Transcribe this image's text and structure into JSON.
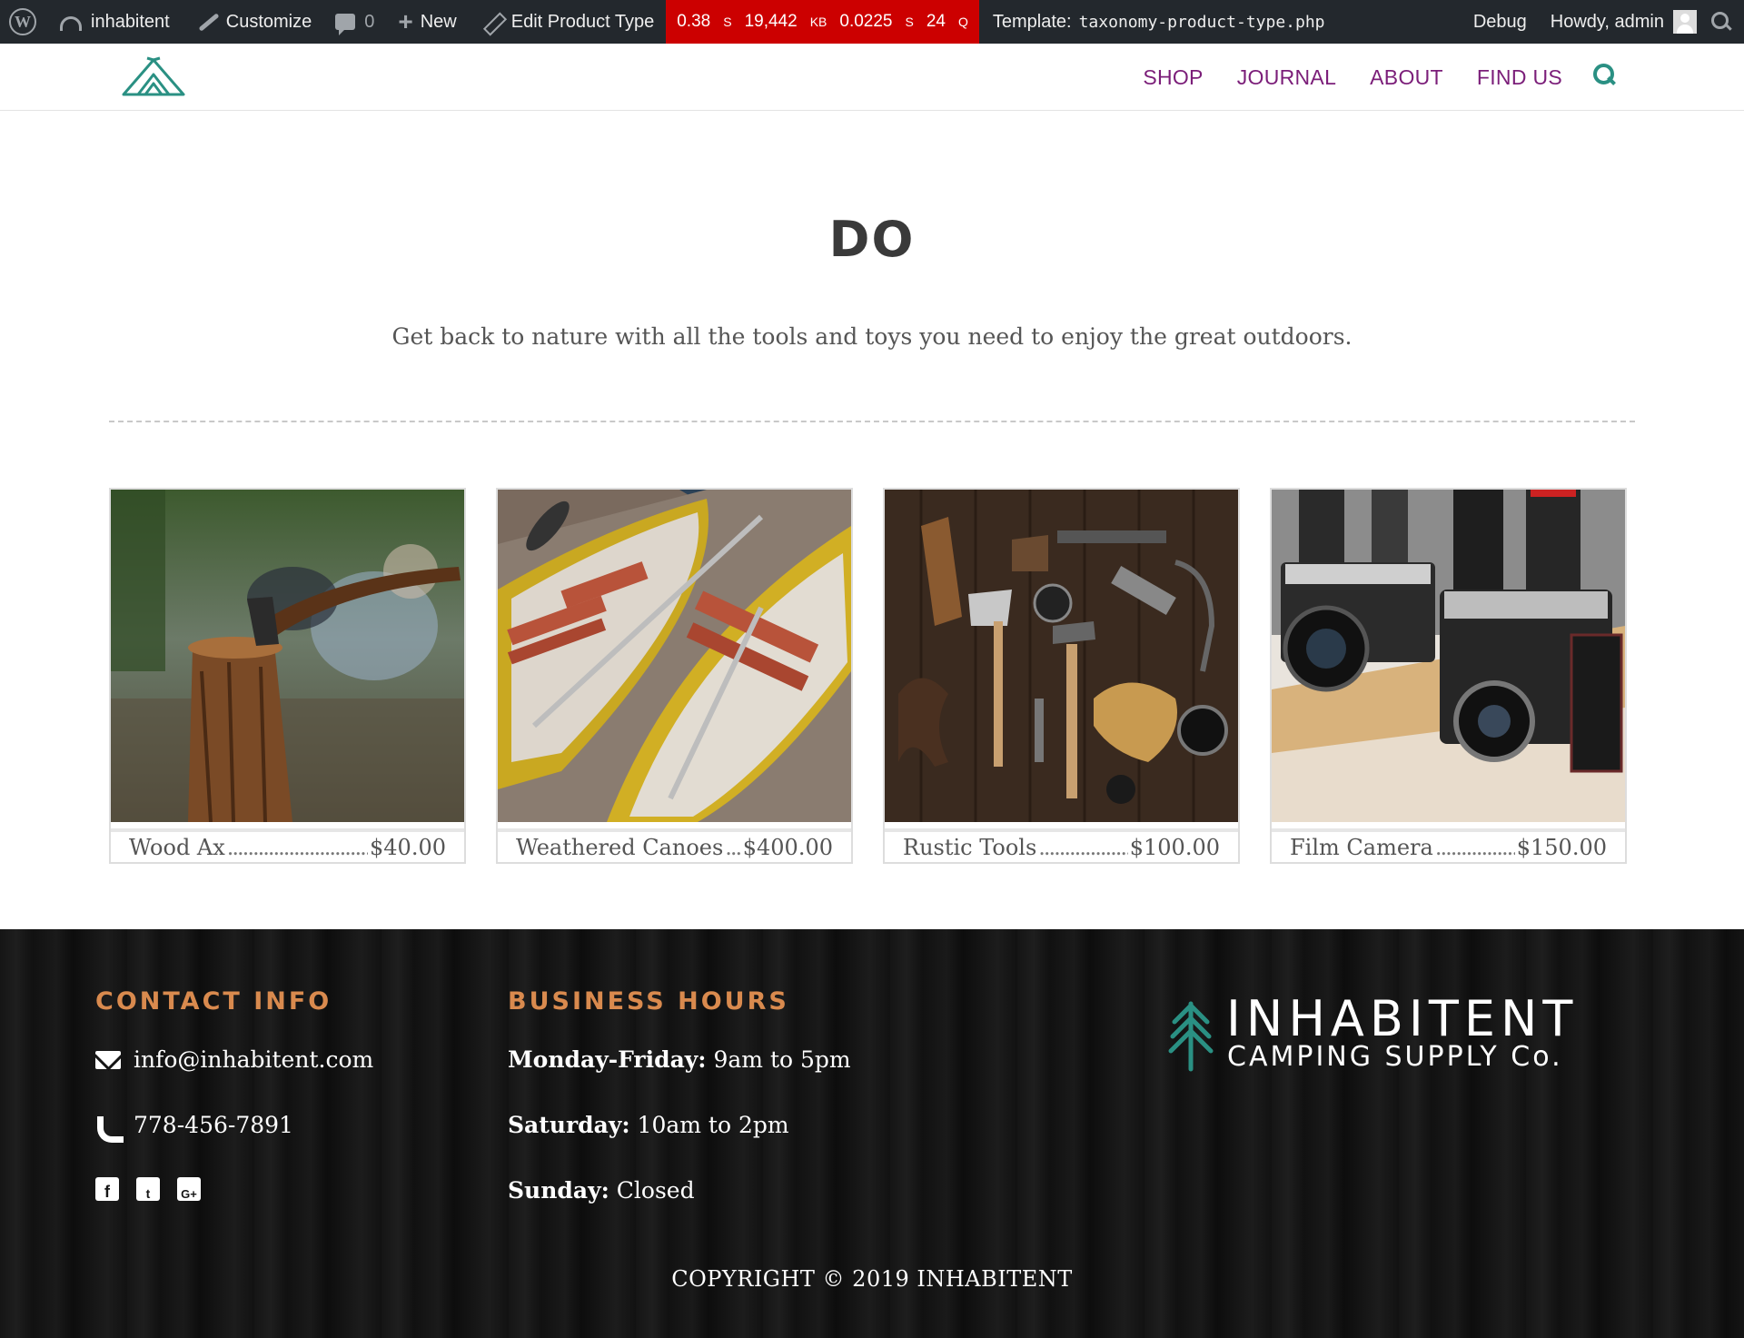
{
  "admin_bar": {
    "site_name": "inhabitent",
    "customize": "Customize",
    "comments_count": "0",
    "new_label": "New",
    "edit_label": "Edit Product Type",
    "perf": {
      "time": "0.38",
      "time_unit": "S",
      "memory": "19,442",
      "memory_unit": "KB",
      "query_time": "0.0225",
      "query_time_unit": "S",
      "queries": "24",
      "queries_unit": "Q"
    },
    "template_label": "Template:",
    "template_file": "taxonomy-product-type.php",
    "debug_label": "Debug",
    "howdy_label": "Howdy, admin"
  },
  "header": {
    "nav": [
      "SHOP",
      "JOURNAL",
      "ABOUT",
      "FIND US"
    ]
  },
  "main": {
    "title": "DO",
    "description": "Get back to nature with all the tools and toys you need to enjoy the great outdoors."
  },
  "products": [
    {
      "name": "Wood Ax",
      "price": "$40.00"
    },
    {
      "name": "Weathered Canoes",
      "price": "$400.00"
    },
    {
      "name": "Rustic Tools",
      "price": "$100.00"
    },
    {
      "name": "Film Camera",
      "price": "$150.00"
    }
  ],
  "footer": {
    "contact_heading": "CONTACT INFO",
    "email": "info@inhabitent.com",
    "phone": "778-456-7891",
    "hours_heading": "BUSINESS HOURS",
    "hours": [
      {
        "day": "Monday-Friday:",
        "time": "9am to 5pm"
      },
      {
        "day": "Saturday:",
        "time": "10am to 2pm"
      },
      {
        "day": "Sunday:",
        "time": "Closed"
      }
    ],
    "brand_name": "INHABITENT",
    "brand_sub": "CAMPING SUPPLY Co.",
    "copyright": "COPYRIGHT © 2019 INHABITENT"
  },
  "colors": {
    "admin_bar_bg": "#23282d",
    "perf_bg": "#cc0000",
    "nav_link": "#7b1e79",
    "accent_teal": "#2a9083",
    "footer_heading": "#d98a4e"
  }
}
